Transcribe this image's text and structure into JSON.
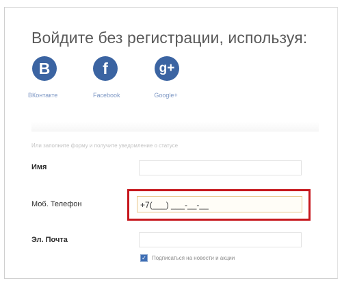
{
  "heading": "Войдите без регистрации, используя:",
  "social": [
    {
      "glyph": "B",
      "label": "ВКонтакте"
    },
    {
      "glyph": "f",
      "label": "Facebook"
    },
    {
      "glyph": "g+",
      "label": "Google+"
    }
  ],
  "hint": "Или заполните форму и получите уведомление о статусе",
  "form": {
    "name_label": "Имя",
    "phone_label": "Моб. Телефон",
    "phone_value": "+7(___) ___-__-__",
    "email_label": "Эл. Почта",
    "subscribe_label": "Подписаться на новости и акции"
  },
  "colors": {
    "social": "#3b64a2",
    "highlight": "#c6161c"
  }
}
